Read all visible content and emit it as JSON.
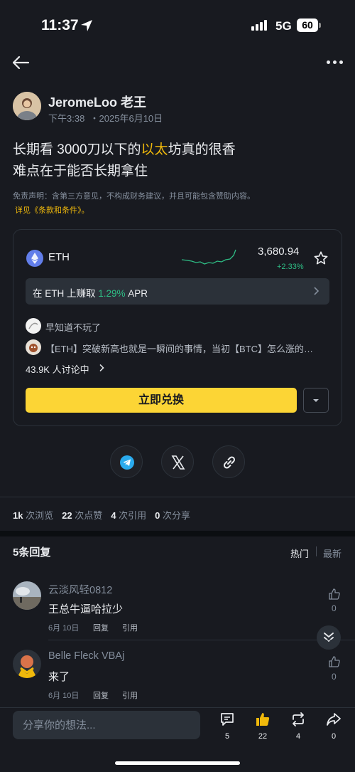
{
  "status": {
    "time": "11:37",
    "network": "5G",
    "battery": "60"
  },
  "post": {
    "author": "JeromeLoo 老王",
    "time": "下午3:38",
    "date": "・2025年6月10日",
    "line1_pre": "长期看 3000刀以下的",
    "line1_highlight": "以太",
    "line1_post": "坊真的很香",
    "line2": "难点在于能否长期拿住",
    "disclaimer": "免责声明：含第三方意见，不构成财务建议，并且可能包含赞助内容。",
    "terms": "详见《条款和条件》。"
  },
  "card": {
    "symbol": "ETH",
    "price": "3,680.94",
    "change": "+2.33%",
    "earn_pre": "在 ETH 上赚取 ",
    "earn_apr": "1.29%",
    "earn_post": " APR",
    "disc1": "早知道不玩了",
    "disc2": "【ETH】突破新高也就是一瞬间的事情，当初【BTC】怎么涨的…",
    "disc_count": "43.9K 人讨论中",
    "swap_label": "立即兑换",
    "accent": "#FCD535",
    "up_color": "#2EBD85"
  },
  "stats": {
    "views_num": "1k",
    "views_label": "次浏览",
    "likes_num": "22",
    "likes_label": "次点赞",
    "quotes_num": "4",
    "quotes_label": "次引用",
    "shares_num": "0",
    "shares_label": "次分享"
  },
  "replies": {
    "title": "5条回复",
    "sort_hot": "热门",
    "sort_new": "最新",
    "items": [
      {
        "name": "云淡风轻0812",
        "text": "王总牛逼哈拉少",
        "date": "6月 10日",
        "reply": "回复",
        "quote": "引用",
        "likes": "0"
      },
      {
        "name": "Belle Fleck VBAj",
        "text": "来了",
        "date": "6月 10日",
        "reply": "回复",
        "quote": "引用",
        "likes": "0"
      }
    ]
  },
  "bottom": {
    "placeholder": "分享你的想法...",
    "comments": "5",
    "likes": "22",
    "reposts": "4",
    "shares": "0"
  }
}
